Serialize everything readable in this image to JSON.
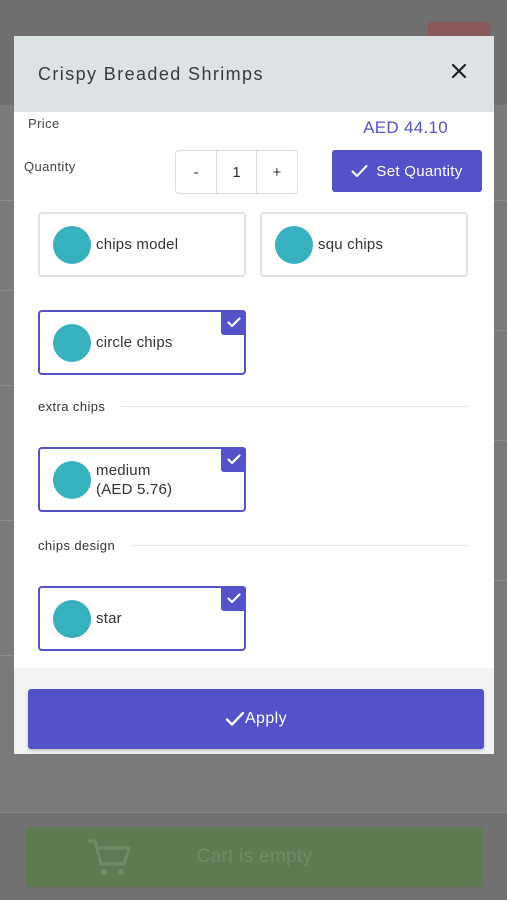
{
  "modal": {
    "title": "Crispy Breaded Shrimps",
    "price_label": "Price",
    "price_value": "AED 44.10",
    "quantity_label": "Quantity",
    "qty_minus": "-",
    "qty_value": "1",
    "qty_plus": "+",
    "set_quantity_label": "Set Quantity",
    "apply_label": "Apply"
  },
  "options": {
    "group1": [
      {
        "label": "chips model",
        "selected": false
      },
      {
        "label": "squ chips",
        "selected": false
      },
      {
        "label": "circle chips",
        "selected": true
      }
    ],
    "sections": [
      {
        "title": "extra chips",
        "items": [
          {
            "label": "medium",
            "sub": "(AED 5.76)",
            "selected": true
          }
        ]
      },
      {
        "title": "chips design",
        "items": [
          {
            "label": "star",
            "selected": true
          }
        ]
      }
    ]
  },
  "background": {
    "cart_label": "Cart is empty"
  },
  "colors": {
    "accent": "#5352c8",
    "option_dot": "#36b1bd",
    "header_bg": "#dde2e5",
    "cart_button": "#5e7a52"
  }
}
